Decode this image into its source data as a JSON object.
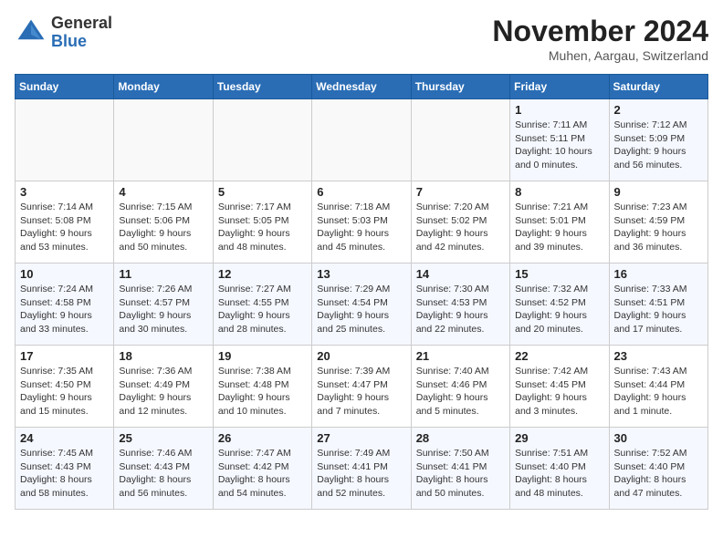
{
  "header": {
    "logo_line1": "General",
    "logo_line2": "Blue",
    "month": "November 2024",
    "location": "Muhen, Aargau, Switzerland"
  },
  "weekdays": [
    "Sunday",
    "Monday",
    "Tuesday",
    "Wednesday",
    "Thursday",
    "Friday",
    "Saturday"
  ],
  "weeks": [
    [
      {
        "day": "",
        "info": ""
      },
      {
        "day": "",
        "info": ""
      },
      {
        "day": "",
        "info": ""
      },
      {
        "day": "",
        "info": ""
      },
      {
        "day": "",
        "info": ""
      },
      {
        "day": "1",
        "info": "Sunrise: 7:11 AM\nSunset: 5:11 PM\nDaylight: 10 hours and 0 minutes."
      },
      {
        "day": "2",
        "info": "Sunrise: 7:12 AM\nSunset: 5:09 PM\nDaylight: 9 hours and 56 minutes."
      }
    ],
    [
      {
        "day": "3",
        "info": "Sunrise: 7:14 AM\nSunset: 5:08 PM\nDaylight: 9 hours and 53 minutes."
      },
      {
        "day": "4",
        "info": "Sunrise: 7:15 AM\nSunset: 5:06 PM\nDaylight: 9 hours and 50 minutes."
      },
      {
        "day": "5",
        "info": "Sunrise: 7:17 AM\nSunset: 5:05 PM\nDaylight: 9 hours and 48 minutes."
      },
      {
        "day": "6",
        "info": "Sunrise: 7:18 AM\nSunset: 5:03 PM\nDaylight: 9 hours and 45 minutes."
      },
      {
        "day": "7",
        "info": "Sunrise: 7:20 AM\nSunset: 5:02 PM\nDaylight: 9 hours and 42 minutes."
      },
      {
        "day": "8",
        "info": "Sunrise: 7:21 AM\nSunset: 5:01 PM\nDaylight: 9 hours and 39 minutes."
      },
      {
        "day": "9",
        "info": "Sunrise: 7:23 AM\nSunset: 4:59 PM\nDaylight: 9 hours and 36 minutes."
      }
    ],
    [
      {
        "day": "10",
        "info": "Sunrise: 7:24 AM\nSunset: 4:58 PM\nDaylight: 9 hours and 33 minutes."
      },
      {
        "day": "11",
        "info": "Sunrise: 7:26 AM\nSunset: 4:57 PM\nDaylight: 9 hours and 30 minutes."
      },
      {
        "day": "12",
        "info": "Sunrise: 7:27 AM\nSunset: 4:55 PM\nDaylight: 9 hours and 28 minutes."
      },
      {
        "day": "13",
        "info": "Sunrise: 7:29 AM\nSunset: 4:54 PM\nDaylight: 9 hours and 25 minutes."
      },
      {
        "day": "14",
        "info": "Sunrise: 7:30 AM\nSunset: 4:53 PM\nDaylight: 9 hours and 22 minutes."
      },
      {
        "day": "15",
        "info": "Sunrise: 7:32 AM\nSunset: 4:52 PM\nDaylight: 9 hours and 20 minutes."
      },
      {
        "day": "16",
        "info": "Sunrise: 7:33 AM\nSunset: 4:51 PM\nDaylight: 9 hours and 17 minutes."
      }
    ],
    [
      {
        "day": "17",
        "info": "Sunrise: 7:35 AM\nSunset: 4:50 PM\nDaylight: 9 hours and 15 minutes."
      },
      {
        "day": "18",
        "info": "Sunrise: 7:36 AM\nSunset: 4:49 PM\nDaylight: 9 hours and 12 minutes."
      },
      {
        "day": "19",
        "info": "Sunrise: 7:38 AM\nSunset: 4:48 PM\nDaylight: 9 hours and 10 minutes."
      },
      {
        "day": "20",
        "info": "Sunrise: 7:39 AM\nSunset: 4:47 PM\nDaylight: 9 hours and 7 minutes."
      },
      {
        "day": "21",
        "info": "Sunrise: 7:40 AM\nSunset: 4:46 PM\nDaylight: 9 hours and 5 minutes."
      },
      {
        "day": "22",
        "info": "Sunrise: 7:42 AM\nSunset: 4:45 PM\nDaylight: 9 hours and 3 minutes."
      },
      {
        "day": "23",
        "info": "Sunrise: 7:43 AM\nSunset: 4:44 PM\nDaylight: 9 hours and 1 minute."
      }
    ],
    [
      {
        "day": "24",
        "info": "Sunrise: 7:45 AM\nSunset: 4:43 PM\nDaylight: 8 hours and 58 minutes."
      },
      {
        "day": "25",
        "info": "Sunrise: 7:46 AM\nSunset: 4:43 PM\nDaylight: 8 hours and 56 minutes."
      },
      {
        "day": "26",
        "info": "Sunrise: 7:47 AM\nSunset: 4:42 PM\nDaylight: 8 hours and 54 minutes."
      },
      {
        "day": "27",
        "info": "Sunrise: 7:49 AM\nSunset: 4:41 PM\nDaylight: 8 hours and 52 minutes."
      },
      {
        "day": "28",
        "info": "Sunrise: 7:50 AM\nSunset: 4:41 PM\nDaylight: 8 hours and 50 minutes."
      },
      {
        "day": "29",
        "info": "Sunrise: 7:51 AM\nSunset: 4:40 PM\nDaylight: 8 hours and 48 minutes."
      },
      {
        "day": "30",
        "info": "Sunrise: 7:52 AM\nSunset: 4:40 PM\nDaylight: 8 hours and 47 minutes."
      }
    ]
  ]
}
